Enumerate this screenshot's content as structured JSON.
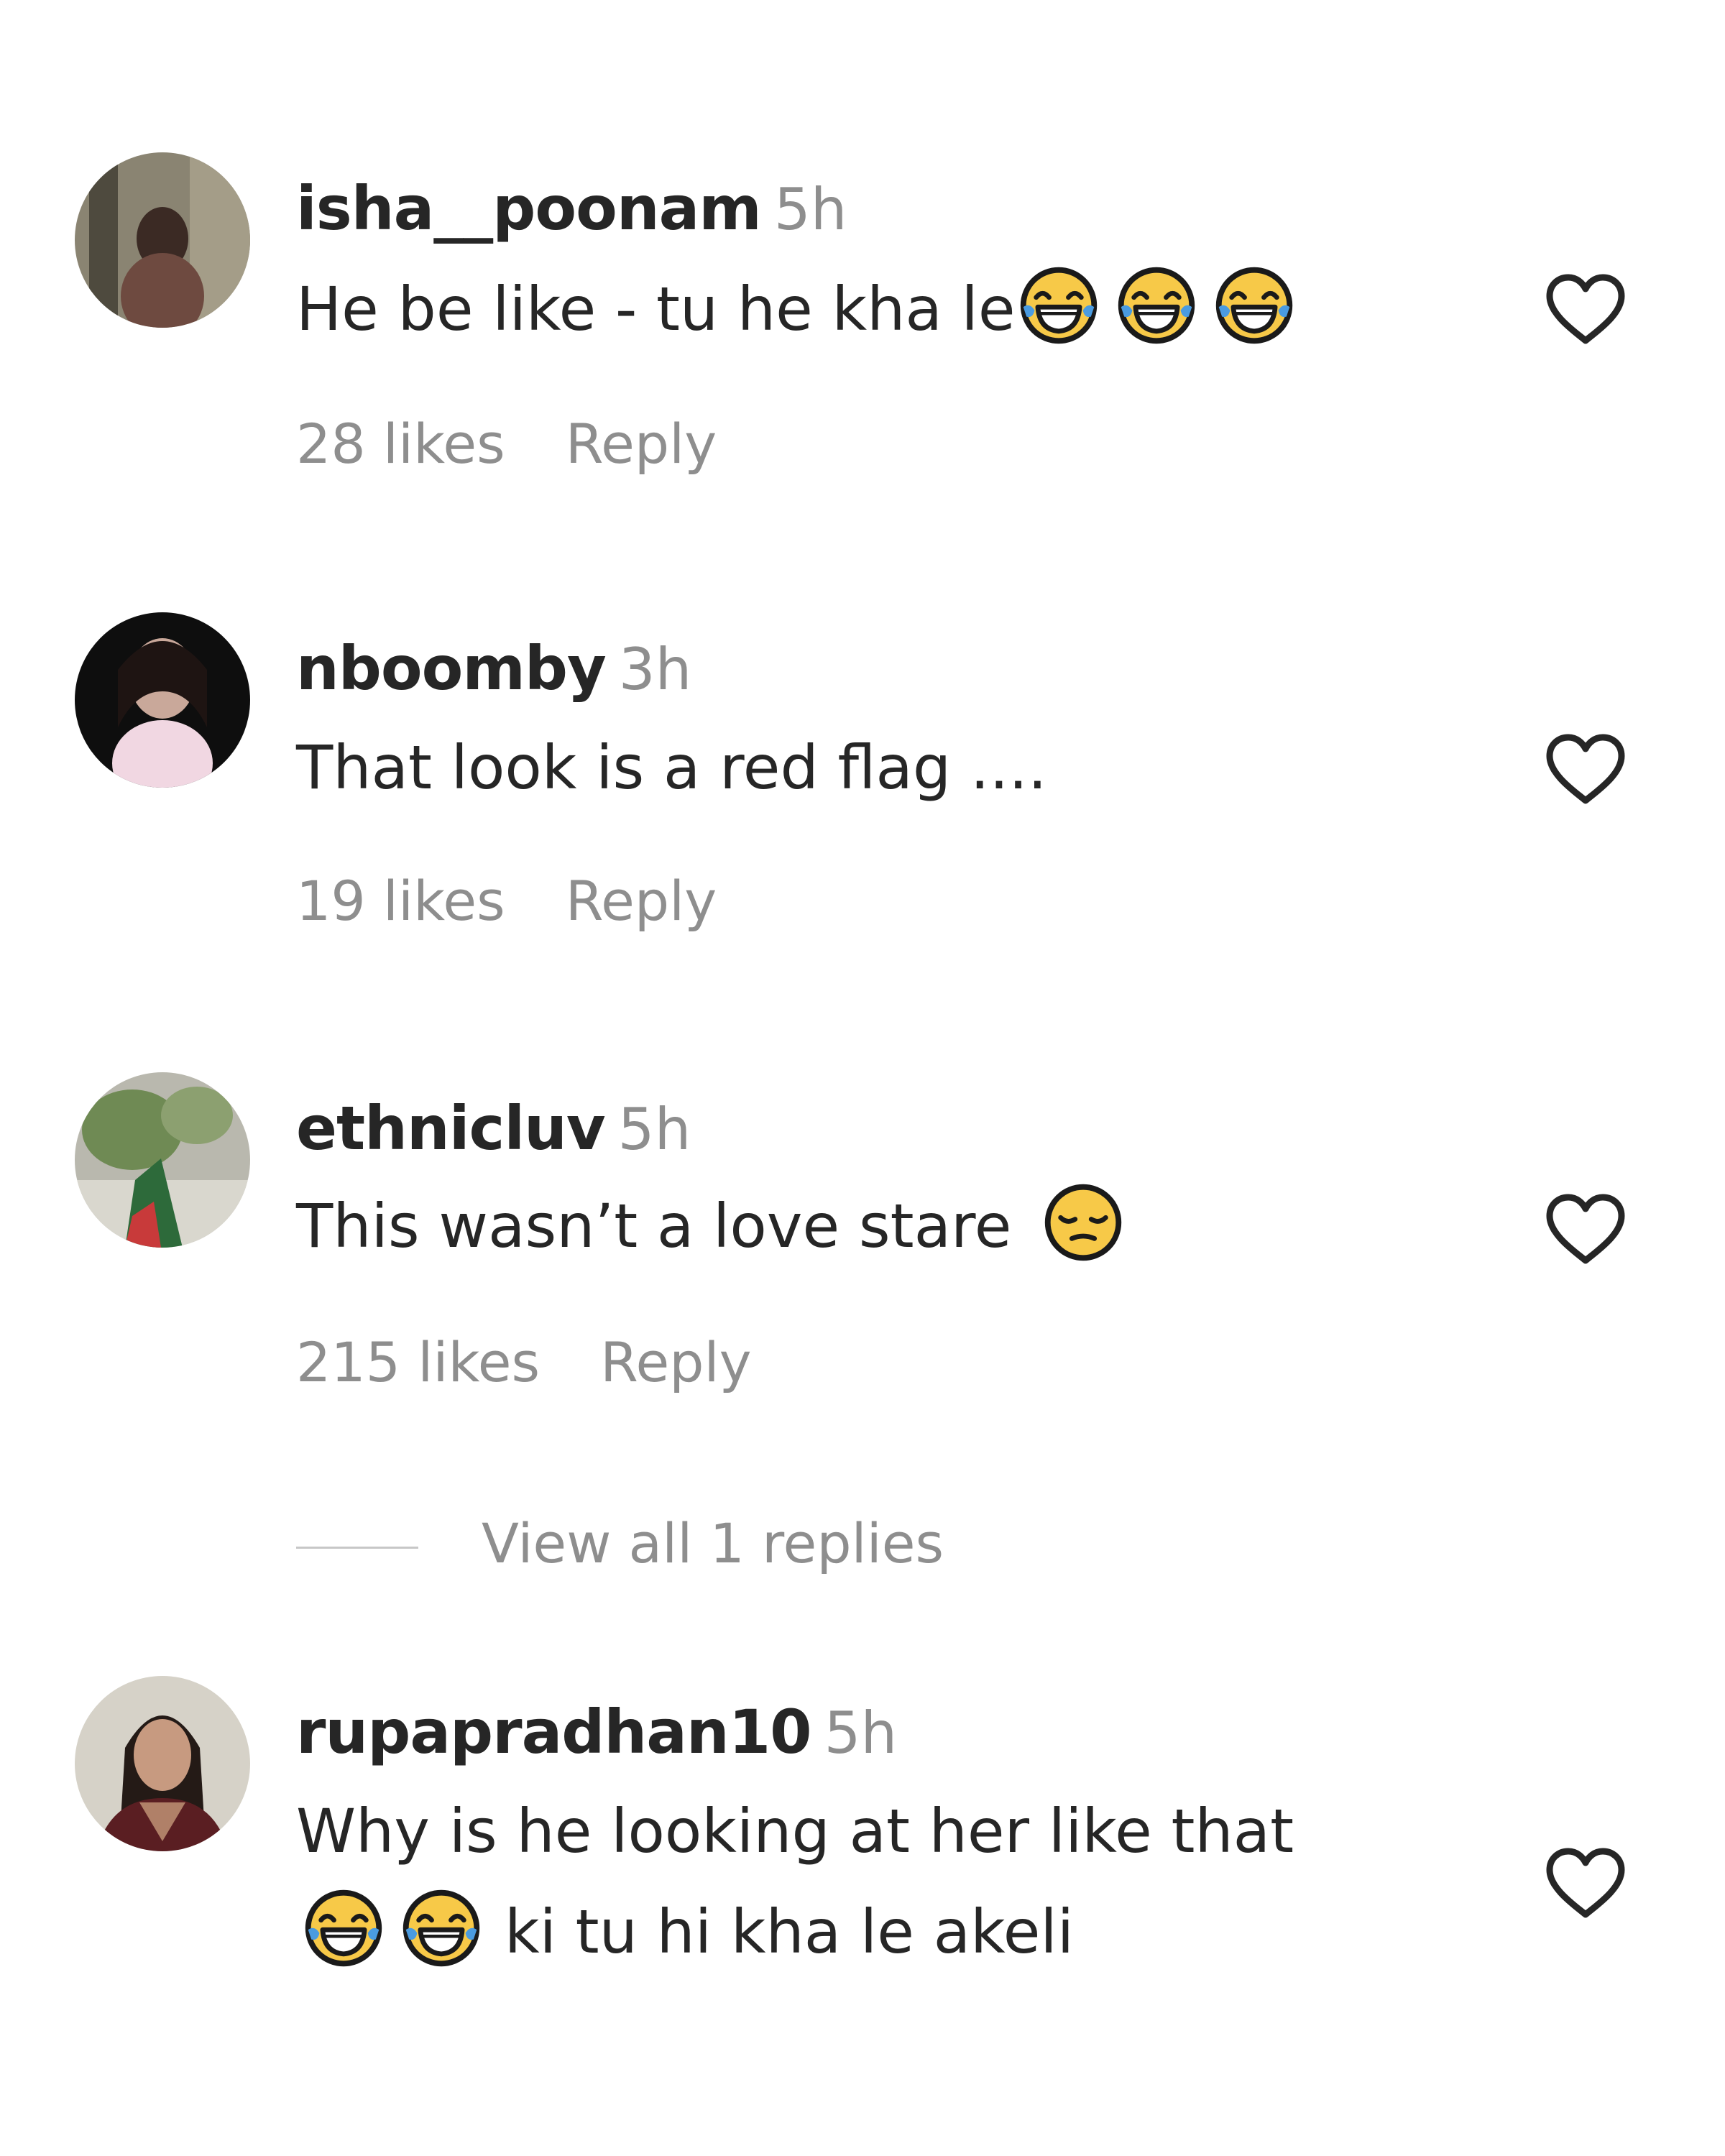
{
  "comments": [
    {
      "username": "isha__poonam",
      "time": "5h",
      "text_before": "He be like - tu he kha le",
      "text_after": "",
      "emojis": [
        "tears-of-joy",
        "tears-of-joy",
        "tears-of-joy"
      ],
      "likes": "28 likes",
      "reply": "Reply"
    },
    {
      "username": "nboomby",
      "time": "3h",
      "text_before": "That look is a red flag ....",
      "likes": "19 likes",
      "reply": "Reply"
    },
    {
      "username": "ethnicluv",
      "time": "5h",
      "text_before": "This wasn’t a love stare",
      "emojis": [
        "pensive-face"
      ],
      "likes": "215 likes",
      "reply": "Reply",
      "view_replies": "View all 1 replies"
    },
    {
      "username": "rupapradhan10",
      "time": "5h",
      "line1": "Why is he looking at her like that",
      "emojis": [
        "tears-of-joy",
        "tears-of-joy"
      ],
      "line2_text": "ki tu hi kha le akeli"
    }
  ],
  "icons": {
    "heart": "heart-outline-icon",
    "laugh": "face-with-tears-of-joy-emoji",
    "pensive": "pensive-face-emoji"
  },
  "colors": {
    "text": "#262626",
    "secondary": "#8e8e8e",
    "emoji_yellow": "#f7c948",
    "tear_blue": "#4a9be0"
  }
}
